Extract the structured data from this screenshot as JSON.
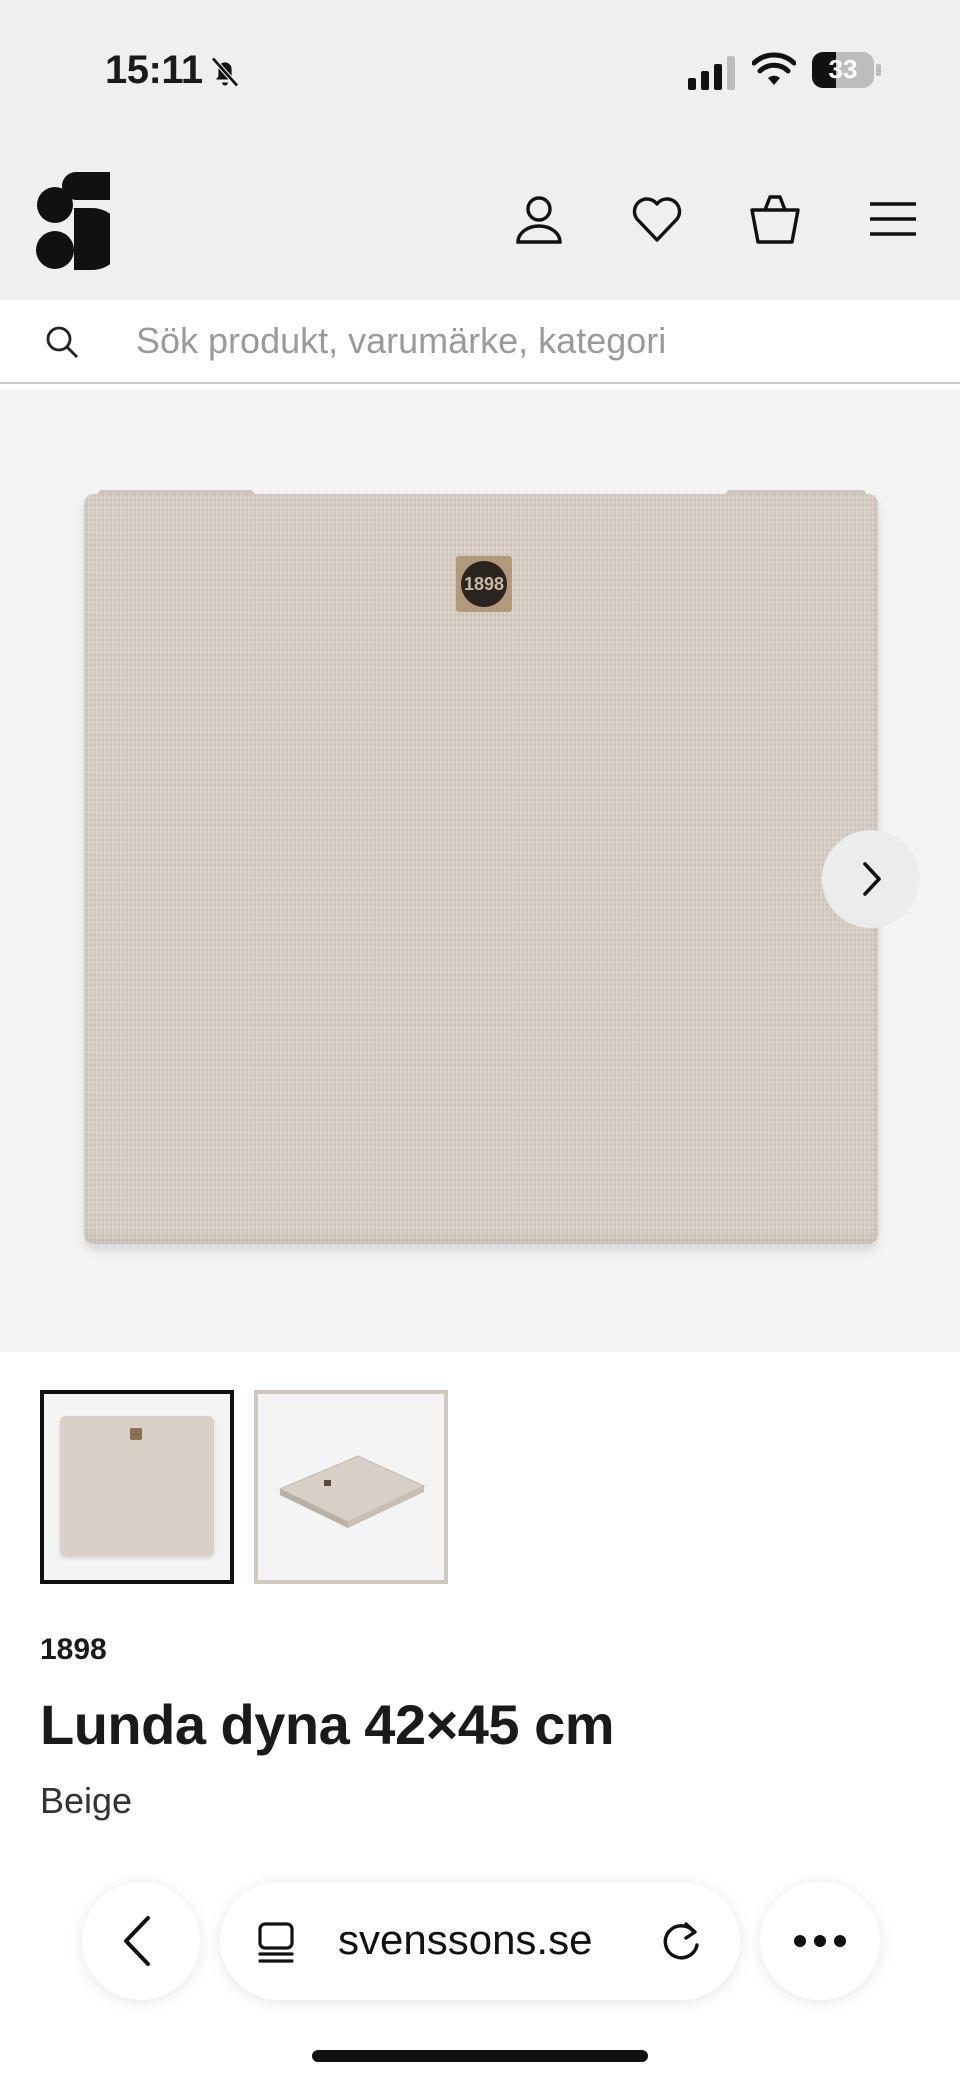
{
  "status_bar": {
    "time": "15:11",
    "battery_level": "33",
    "icons": [
      "bell-slash-icon",
      "signal-icon",
      "wifi-icon",
      "battery-icon"
    ]
  },
  "header": {
    "logo": "S",
    "icons": [
      "account-icon",
      "heart-icon",
      "basket-icon",
      "menu-icon"
    ]
  },
  "search": {
    "placeholder": "Sök produkt, varumärke, kategori"
  },
  "gallery": {
    "label_patch_text": "1898",
    "thumbnails_count": 2,
    "selected_thumbnail": 1,
    "next_icon": "chevron-right-icon"
  },
  "product": {
    "brand": "1898",
    "title": "Lunda dyna 42×45 cm",
    "variant": "Beige"
  },
  "browser_bar": {
    "domain": "svenssons.se",
    "icons": [
      "back-icon",
      "tabs-icon",
      "reload-icon",
      "more-icon"
    ]
  },
  "colors": {
    "header_bg": "#efefef",
    "cushion": "#d8cfc6",
    "text": "#1a1a1a"
  }
}
